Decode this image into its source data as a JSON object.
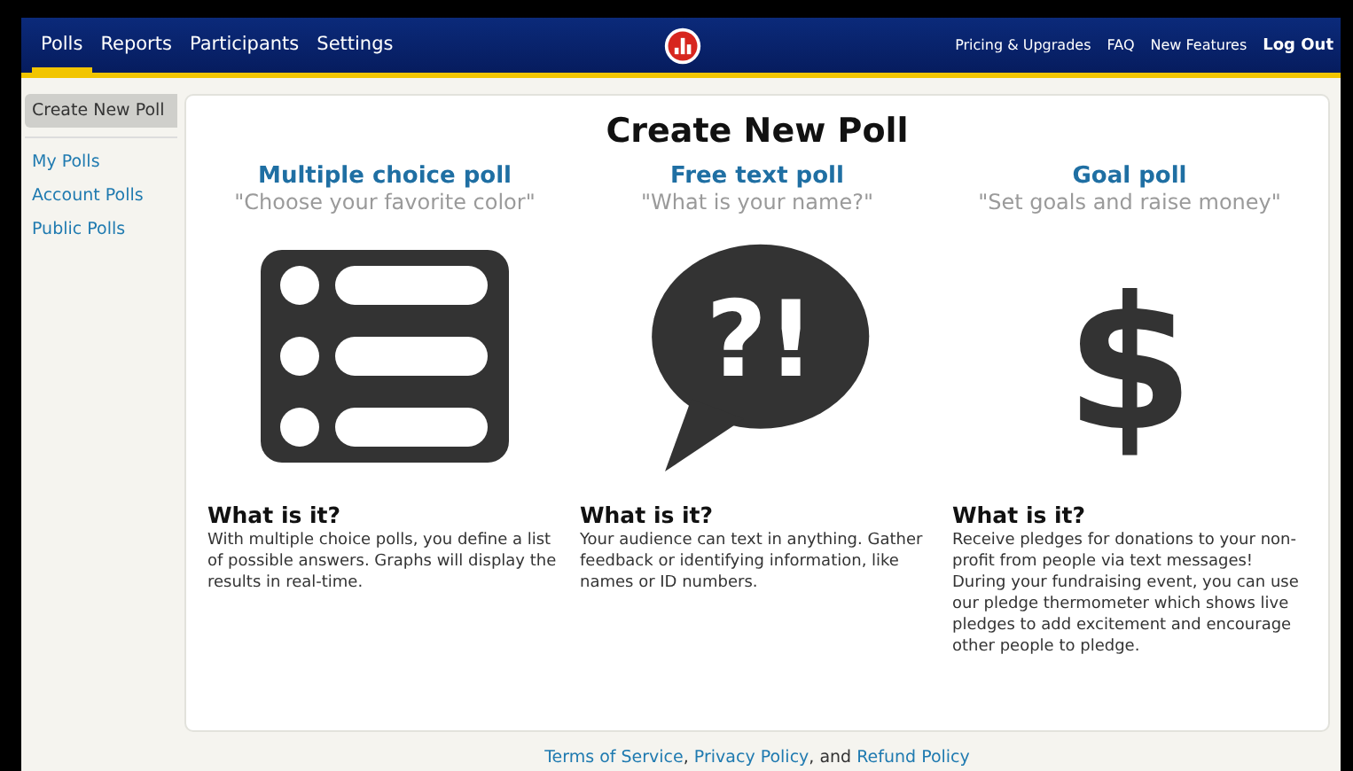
{
  "nav": {
    "tabs": [
      {
        "label": "Polls",
        "selected": true
      },
      {
        "label": "Reports",
        "selected": false
      },
      {
        "label": "Participants",
        "selected": false
      },
      {
        "label": "Settings",
        "selected": false
      }
    ],
    "links": [
      {
        "label": "Pricing & Upgrades",
        "bold": false
      },
      {
        "label": "FAQ",
        "bold": false
      },
      {
        "label": "New Features",
        "bold": false
      },
      {
        "label": "Log Out",
        "bold": true
      }
    ]
  },
  "sidebar": {
    "items": [
      {
        "label": "Create New Poll",
        "selected": true
      },
      {
        "label": "My Polls",
        "selected": false
      },
      {
        "label": "Account Polls",
        "selected": false
      },
      {
        "label": "Public Polls",
        "selected": false
      }
    ]
  },
  "main": {
    "title": "Create New Poll",
    "poll_types": [
      {
        "kind": "list",
        "title": "Multiple choice poll",
        "example": "\"Choose your favorite color\"",
        "heading": "What is it?",
        "description": "With multiple choice polls, you define a list of possible answers. Graphs will display the results in real-time."
      },
      {
        "kind": "bubble",
        "glyph": "?!",
        "title": "Free text poll",
        "example": "\"What is your name?\"",
        "heading": "What is it?",
        "description": "Your audience can text in anything. Gather feedback or identifying information, like names or ID numbers."
      },
      {
        "kind": "sign",
        "glyph": "$",
        "title": "Goal poll",
        "example": "\"Set goals and raise money\"",
        "heading": "What is it?",
        "description": "Receive pledges for donations to your non-profit from people via text messages! During your fundraising event, you can use our pledge thermometer which shows live pledges to add excitement and encourage other people to pledge."
      }
    ]
  },
  "footer": {
    "parts": [
      {
        "kind": "link",
        "text": "Terms of Service"
      },
      {
        "kind": "text",
        "text": ", "
      },
      {
        "kind": "link",
        "text": "Privacy Policy"
      },
      {
        "kind": "text",
        "text": ", and "
      },
      {
        "kind": "link",
        "text": "Refund Policy"
      }
    ]
  }
}
